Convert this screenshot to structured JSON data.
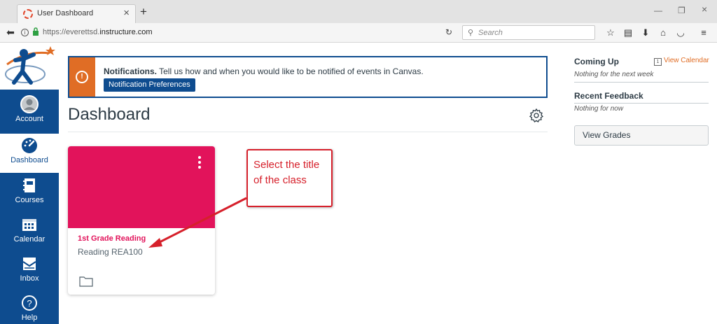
{
  "browser": {
    "tab_title": "User Dashboard",
    "url_prefix": "https://everettsd.",
    "url_domain": "instructure.com",
    "search_placeholder": "Search"
  },
  "global_nav": {
    "items": [
      {
        "label": "Account",
        "icon": "avatar-icon"
      },
      {
        "label": "Dashboard",
        "icon": "dashboard-icon"
      },
      {
        "label": "Courses",
        "icon": "courses-icon"
      },
      {
        "label": "Calendar",
        "icon": "calendar-icon"
      },
      {
        "label": "Inbox",
        "icon": "inbox-icon"
      },
      {
        "label": "Help",
        "icon": "help-icon"
      }
    ],
    "active": "Dashboard",
    "nav_color": "#0e4c8f"
  },
  "notification": {
    "bold": "Notifications.",
    "text": " Tell us how and when you would like to be notified of events in Canvas.",
    "button": "Notification Preferences",
    "accent": "#e06d25"
  },
  "dashboard": {
    "title": "Dashboard",
    "cards": [
      {
        "title": "1st Grade Reading",
        "subtitle": "Reading REA100",
        "color": "#e2135b"
      }
    ]
  },
  "annotation": {
    "text": "Select the title of the class",
    "color": "#d6202b"
  },
  "sidebar": {
    "coming_up": "Coming Up",
    "view_calendar": "View Calendar",
    "coming_up_note": "Nothing for the next week",
    "recent_feedback": "Recent Feedback",
    "recent_feedback_note": "Nothing for now",
    "view_grades": "View Grades"
  }
}
